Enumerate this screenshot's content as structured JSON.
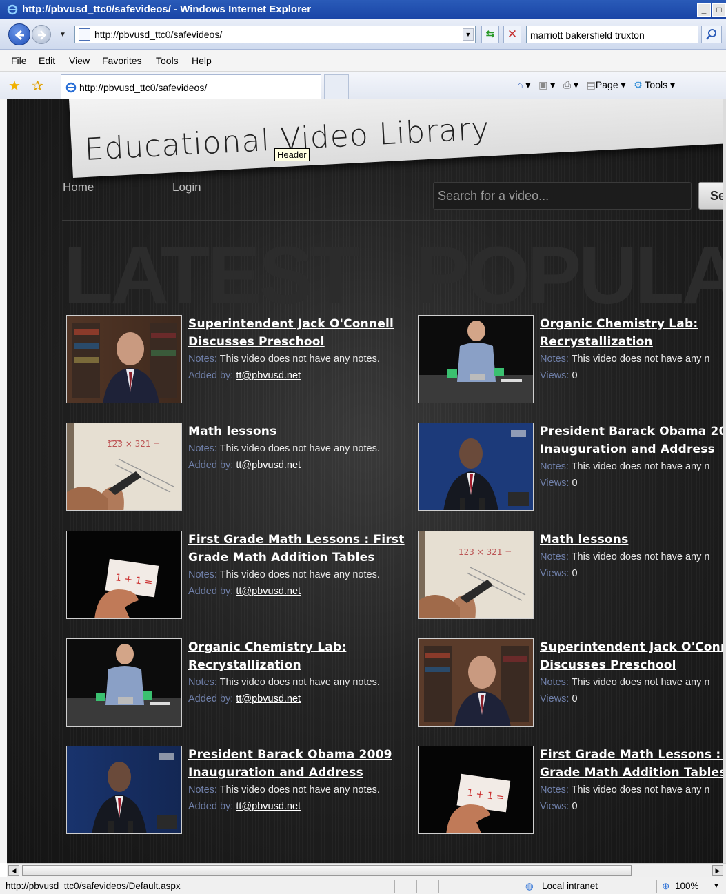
{
  "window": {
    "title": "http://pbvusd_ttc0/safevideos/ - Windows Internet Explorer",
    "address": "http://pbvusd_ttc0/safevideos/",
    "search_value": "marriott bakersfield truxton",
    "menu": [
      "File",
      "Edit",
      "View",
      "Favorites",
      "Tools",
      "Help"
    ],
    "tab_label": "http://pbvusd_ttc0/safevideos/",
    "cmd_page": "Page",
    "cmd_tools": "Tools",
    "status_url": "http://pbvusd_ttc0/safevideos/Default.aspx",
    "status_zone": "Local intranet",
    "zoom": "100%"
  },
  "site": {
    "title": "Educational Video Library",
    "tooltip": "Header",
    "nav": [
      "Home",
      "Login"
    ],
    "search_placeholder": "Search for a video...",
    "search_button": "Se",
    "section_latest": "LATEST",
    "section_popular": "POPULA"
  },
  "labels": {
    "notes": "Notes:",
    "added_by": "Added by:",
    "views": "Views:"
  },
  "latest": [
    {
      "title": "Superintendent Jack O'Connell Discusses Preschool",
      "notes": "This video does not have any notes.",
      "added_by": "tt@pbvusd.net",
      "thumb": "library-speaker"
    },
    {
      "title": "Math lessons",
      "notes": "This video does not have any notes.",
      "added_by": "tt@pbvusd.net",
      "thumb": "math-paper"
    },
    {
      "title": "First Grade Math Lessons : First Grade Math Addition Tables",
      "notes": "This video does not have any notes.",
      "added_by": "tt@pbvusd.net",
      "thumb": "flash-card"
    },
    {
      "title": "Organic Chemistry Lab: Recrystallization",
      "notes": "This video does not have any notes.",
      "added_by": "tt@pbvusd.net",
      "thumb": "chem-lab"
    },
    {
      "title": "President Barack Obama 2009 Inauguration and Address",
      "notes": "This video does not have any notes.",
      "added_by": "tt@pbvusd.net",
      "thumb": "podium-speaker"
    }
  ],
  "popular": [
    {
      "title": "Organic Chemistry Lab: Recrystallization",
      "notes": "This video does not have any n",
      "views": "0",
      "thumb": "chem-lab"
    },
    {
      "title": "President Barack Obama 200 Inauguration and Address",
      "notes": "This video does not have any n",
      "views": "0",
      "thumb": "podium-speaker"
    },
    {
      "title": "Math lessons",
      "notes": "This video does not have any n",
      "views": "0",
      "thumb": "math-paper"
    },
    {
      "title": "Superintendent Jack O'Conn Discusses Preschool",
      "notes": "This video does not have any n",
      "views": "0",
      "thumb": "library-speaker"
    },
    {
      "title": "First Grade Math Lessons : Fi Grade Math Addition Tables",
      "notes": "This video does not have any n",
      "views": "0",
      "thumb": "flash-card"
    }
  ]
}
